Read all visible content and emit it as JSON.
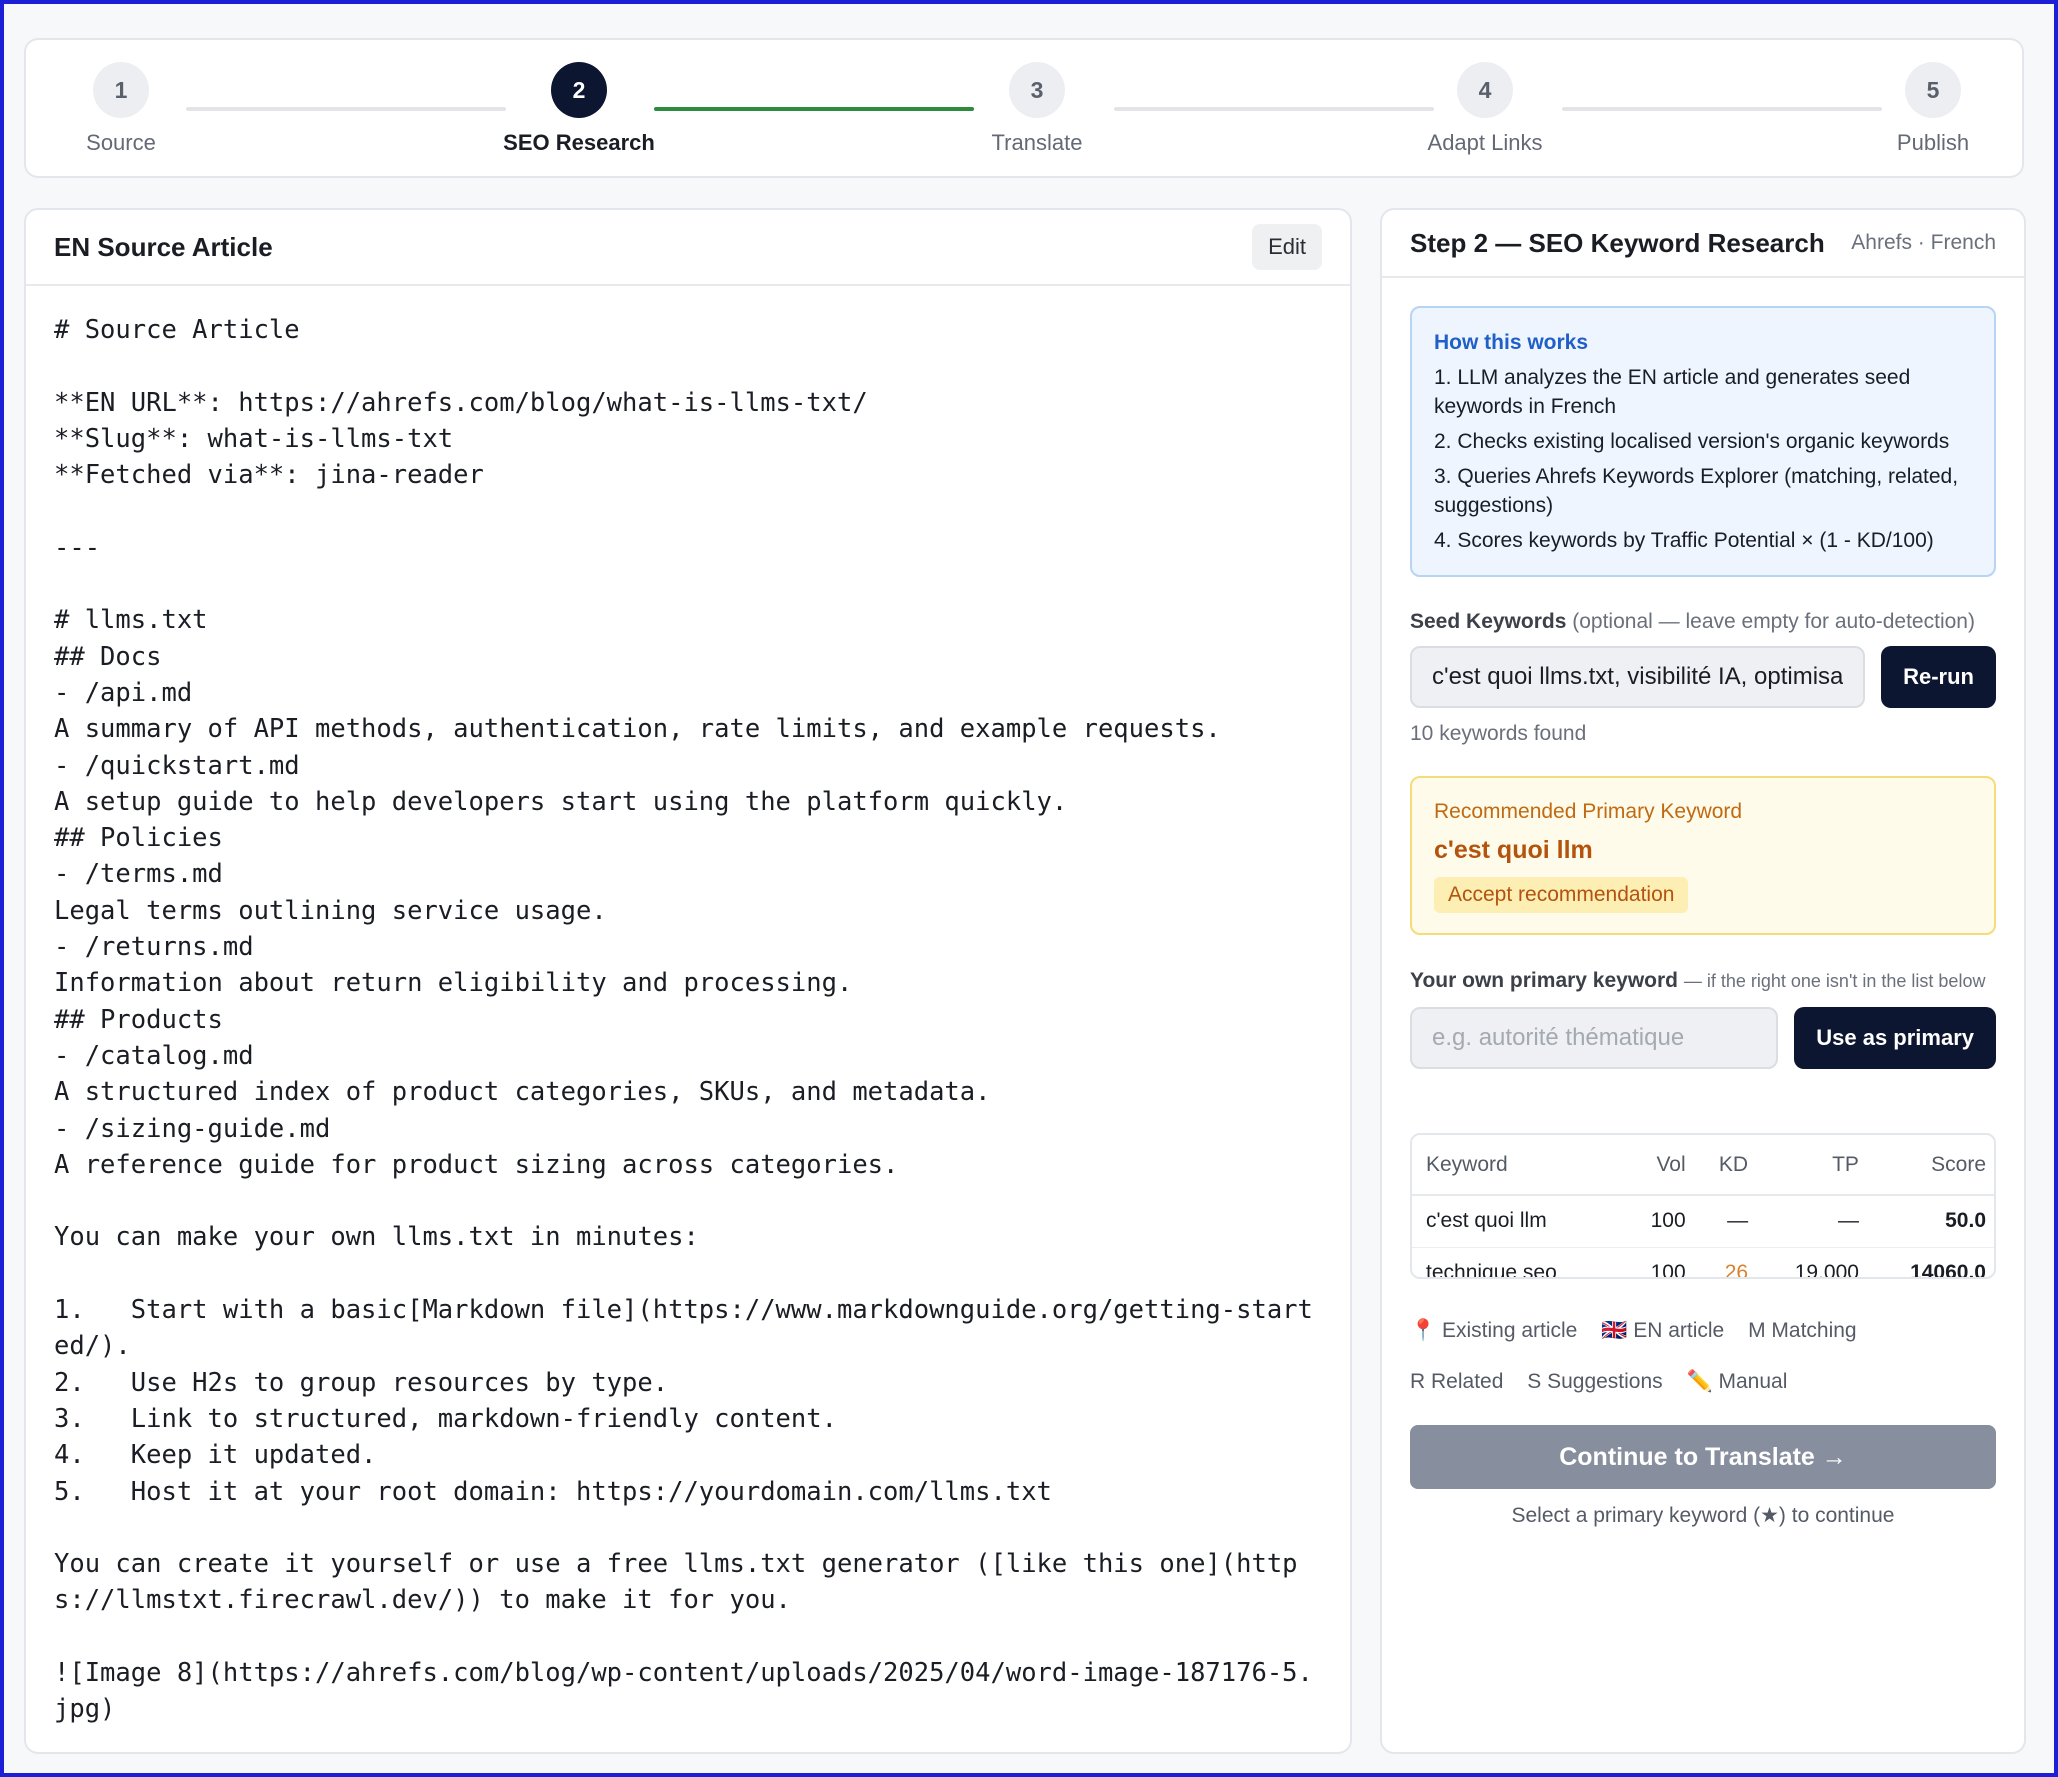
{
  "stepper": {
    "steps": [
      {
        "num": "1",
        "label": "Source"
      },
      {
        "num": "2",
        "label": "SEO Research"
      },
      {
        "num": "3",
        "label": "Translate"
      },
      {
        "num": "4",
        "label": "Adapt Links"
      },
      {
        "num": "5",
        "label": "Publish"
      }
    ],
    "active_step": 2
  },
  "source": {
    "title": "EN Source Article",
    "edit_label": "Edit",
    "markdown": "# Source Article\n\n**EN URL**: https://ahrefs.com/blog/what-is-llms-txt/\n**Slug**: what-is-llms-txt\n**Fetched via**: jina-reader\n\n---\n\n# llms.txt\n## Docs\n- /api.md\nA summary of API methods, authentication, rate limits, and example requests.\n- /quickstart.md\nA setup guide to help developers start using the platform quickly.\n## Policies\n- /terms.md\nLegal terms outlining service usage.\n- /returns.md\nInformation about return eligibility and processing.\n## Products\n- /catalog.md\nA structured index of product categories, SKUs, and metadata.\n- /sizing-guide.md\nA reference guide for product sizing across categories.\n\nYou can make your own llms.txt in minutes:\n\n1.   Start with a basic[Markdown file](https://www.markdownguide.org/getting-started/).\n2.   Use H2s to group resources by type.\n3.   Link to structured, markdown-friendly content.\n4.   Keep it updated.\n5.   Host it at your root domain: https://yourdomain.com/llms.txt\n\nYou can create it yourself or use a free llms.txt generator ([like this one](https://llmstxt.firecrawl.dev/)) to make it for you.\n\n![Image 8](https://ahrefs.com/blog/wp-content/uploads/2025/04/word-image-187176-5.jpg)"
  },
  "seo": {
    "title": "Step 2 — SEO Keyword Research",
    "subtitle": "Ahrefs · French",
    "how": {
      "title": "How this works",
      "items": [
        "1. LLM analyzes the EN article and generates seed keywords in French",
        "2. Checks existing localised version's organic keywords",
        "3. Queries Ahrefs Keywords Explorer (matching, related, suggestions)",
        "4. Scores keywords by Traffic Potential × (1 - KD/100)"
      ]
    },
    "seed": {
      "label": "Seed Keywords",
      "hint": "(optional — leave empty for auto-detection)",
      "value": "c'est quoi llms.txt, visibilité IA, optimisation",
      "button": "Re-run",
      "count": "10 keywords found"
    },
    "recommended": {
      "title": "Recommended Primary Keyword",
      "keyword": "c'est quoi llm",
      "accept": "Accept recommendation"
    },
    "own": {
      "label": "Your own primary keyword",
      "hint": "— if the right one isn't in the list below",
      "placeholder": "e.g. autorité thématique",
      "button": "Use as primary"
    },
    "table": {
      "headers": [
        "Keyword",
        "Vol",
        "KD",
        "TP",
        "Score"
      ],
      "rows": [
        {
          "keyword": "c'est quoi llm",
          "vol": "100",
          "kd": "—",
          "tp": "—",
          "score": "50.0"
        },
        {
          "keyword": "technique seo",
          "vol": "100",
          "kd": "26",
          "tp": "19,000",
          "score": "14060.0"
        }
      ]
    },
    "legend": [
      "📍 Existing article",
      "🇬🇧 EN article",
      "M Matching",
      "R Related",
      "S Suggestions",
      "✏️ Manual"
    ],
    "continue": "Continue to Translate →",
    "continue_hint": "Select a primary keyword (★) to continue",
    "colors": {
      "accent": "#0d1630",
      "progress": "#2e8b3e",
      "info": "#1f5fc7",
      "warning": "#b4530d"
    }
  }
}
